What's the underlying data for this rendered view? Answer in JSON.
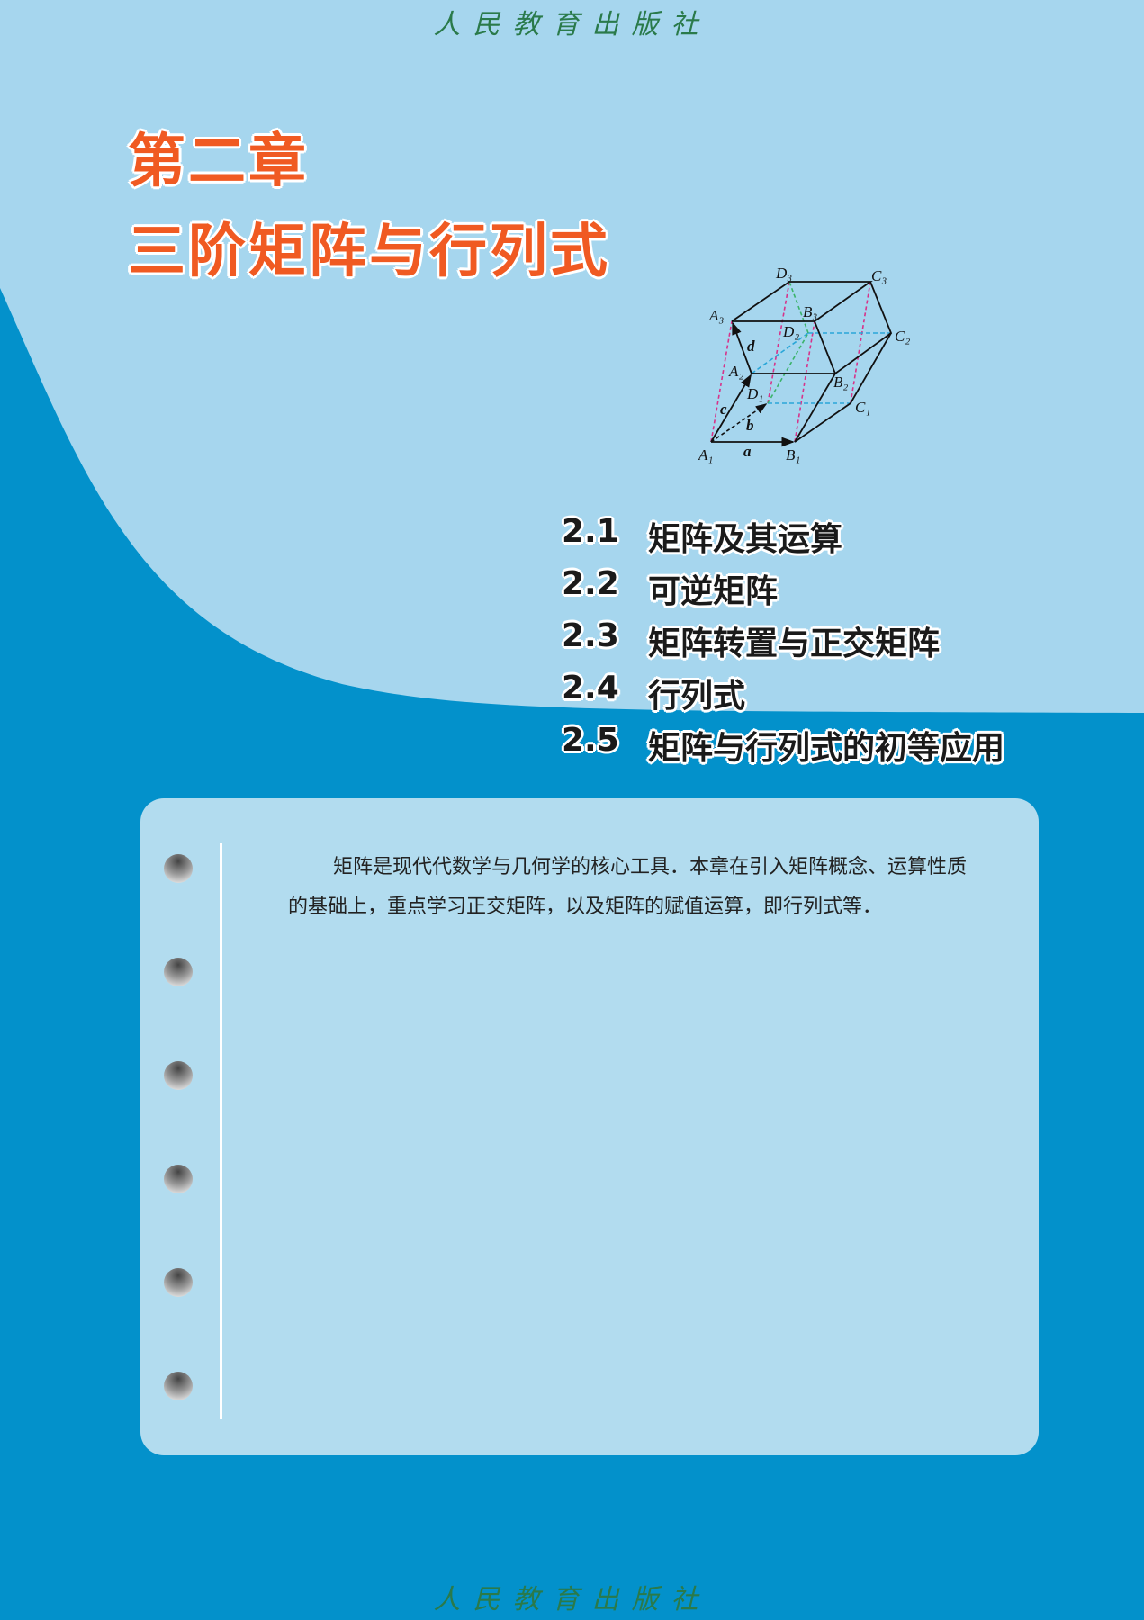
{
  "publisher_logo": "人民教育出版社",
  "chapter": {
    "number_label": "第二章",
    "title": "三阶矩阵与行列式"
  },
  "diagram": {
    "labels": {
      "A1": "A₁",
      "B1": "B₁",
      "C1": "C₁",
      "D1": "D₁",
      "A2": "A₂",
      "B2": "B₂",
      "C2": "C₂",
      "D2": "D₂",
      "A3": "A₃",
      "B3": "B₃",
      "C3": "C₃",
      "D3": "D₃",
      "a": "a",
      "b": "b",
      "c": "c",
      "d": "d"
    }
  },
  "toc": [
    {
      "num": "2.1",
      "title": "矩阵及其运算"
    },
    {
      "num": "2.2",
      "title": "可逆矩阵"
    },
    {
      "num": "2.3",
      "title": "矩阵转置与正交矩阵"
    },
    {
      "num": "2.4",
      "title": "行列式"
    },
    {
      "num": "2.5",
      "title": "矩阵与行列式的初等应用"
    }
  ],
  "intro": "矩阵是现代代数学与几何学的核心工具．本章在引入矩阵概念、运算性质的基础上，重点学习正交矩阵，以及矩阵的赋值运算，即行列式等．",
  "colors": {
    "light_blue": "#a6d6ee",
    "dark_blue": "#0391cb",
    "card": "#b2dcef",
    "title_orange": "#f05a22",
    "logo_green": "#2a7a4a"
  }
}
